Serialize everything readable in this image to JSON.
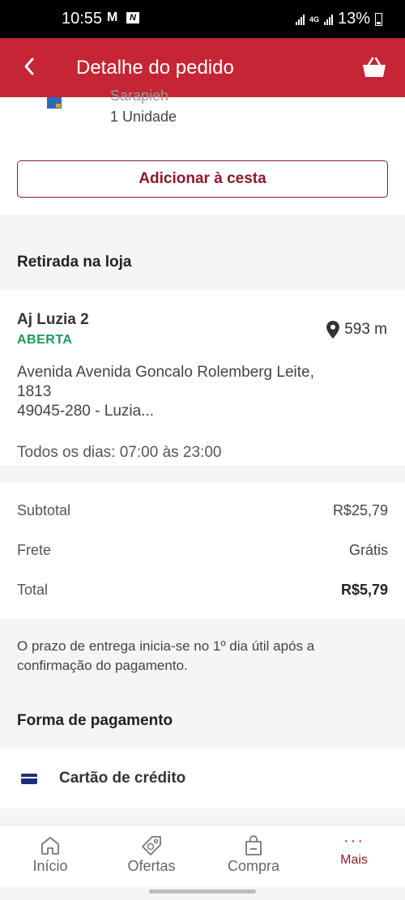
{
  "status_bar": {
    "time": "10:55",
    "mail_icon_text": "M",
    "app_badge": "N",
    "network": "4G",
    "battery": "13%"
  },
  "header": {
    "title": "Detalhe do pedido",
    "back_icon": "chevron-left-icon",
    "basket_icon": "basket-icon"
  },
  "item": {
    "name": "Sarapieh",
    "quantity": "1 Unidade",
    "add_button": "Adicionar à cesta"
  },
  "pickup": {
    "section_title": "Retirada na loja",
    "store_name": "Aj Luzia 2",
    "store_status": "ABERTA",
    "distance": "593 m",
    "address_line1": "Avenida Avenida Goncalo Rolemberg Leite,",
    "address_line2": "1813",
    "address_line3": "49045-280 - Luzia...",
    "hours": "Todos os dias: 07:00 às 23:00"
  },
  "summary": {
    "subtotal_label": "Subtotal",
    "subtotal_value": "R$25,79",
    "shipping_label": "Frete",
    "shipping_value": "Grátis",
    "total_label": "Total",
    "total_value": "R$5,79"
  },
  "notice": "O prazo de entrega inicia-se no 1º dia útil após a confirmação do pagamento.",
  "payment": {
    "section_title": "Forma de pagamento",
    "method": "Cartão de crédito"
  },
  "nav": {
    "home": "Início",
    "offers": "Ofertas",
    "cart": "Compra",
    "more": "Mais",
    "more_dots": "···"
  },
  "colors": {
    "brand": "#c52534",
    "accent_dark": "#8a1a2b",
    "open_green": "#1a9a5a",
    "card_icon": "#1f2d7a"
  }
}
